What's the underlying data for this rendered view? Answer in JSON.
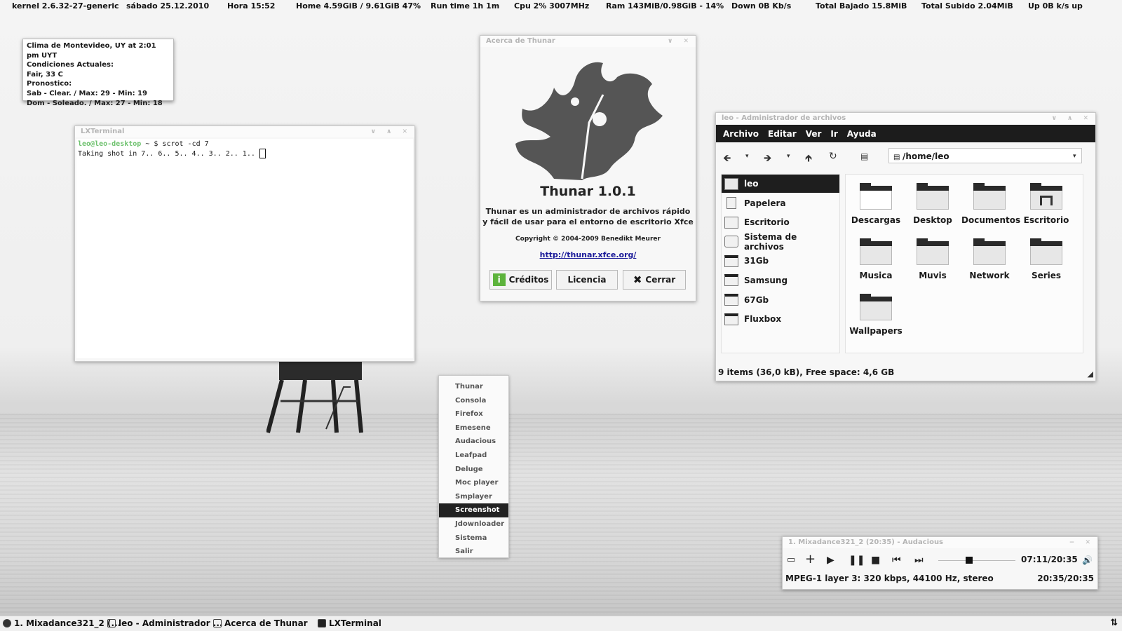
{
  "conky": {
    "kernel": "kernel  2.6.32-27-generic",
    "date": "sábado  25.12.2010",
    "time": "Hora  15:52",
    "home": "Home 4.59GiB  / 9.61GiB  47%",
    "runtime": "Run time 1h 1m",
    "cpu": "Cpu 2%  3007MHz",
    "ram": "Ram 143MiB/0.98GiB - 14%",
    "down": "Down 0B   Kb/s",
    "total_down": "Total Bajado  15.8MiB",
    "total_up": "Total Subido  2.04MiB",
    "up": "Up  0B  k/s up"
  },
  "weather": {
    "lines": [
      "Clima de Montevideo, UY at 2:01 pm UYT",
      "Condiciones Actuales:",
      "Fair, 33 C",
      "Pronostico:",
      "Sab - Clear. / Max: 29 - Min: 19",
      "Dom - Soleado. / Max: 27 - Min: 18"
    ]
  },
  "terminal": {
    "title": "LXTerminal",
    "prompt_user": "leo@leo-desktop",
    "prompt_rest": " ~ $ ",
    "command": "scrot -cd 7",
    "output": "Taking shot in 7.. 6.. 5.. 4.. 3.. 2.. 1.. "
  },
  "about": {
    "window_title": "Acerca de Thunar",
    "app_name": "Thunar 1.0.1",
    "description_line1": "Thunar es un administrador de archivos rápido",
    "description_line2": "y fácil de usar para el entorno de escritorio Xfce",
    "copyright": "Copyright © 2004-2009 Benedikt Meurer",
    "url": "http://thunar.xfce.org/",
    "btn_credits": "Créditos",
    "btn_license": "Licencia",
    "btn_close": "Cerrar"
  },
  "filemanager": {
    "title": "leo - Administrador de archivos",
    "menu": [
      "Archivo",
      "Editar",
      "Ver",
      "Ir",
      "Ayuda"
    ],
    "location": "/home/leo",
    "sidebar": [
      "leo",
      "Papelera",
      "Escritorio",
      "Sistema de archivos",
      "31Gb",
      "Samsung",
      "67Gb",
      "Fluxbox"
    ],
    "files": [
      "Descargas",
      "Desktop",
      "Documentos",
      "Escritorio",
      "Musica",
      "Muvis",
      "Network",
      "Series",
      "Wallpapers"
    ],
    "status": "9 items (36,0 kB), Free space: 4,6 GB"
  },
  "popup_menu": {
    "items": [
      "Thunar",
      "Consola",
      "Firefox",
      "Emesene",
      "Audacious",
      "Leafpad",
      "Deluge",
      "Moc player",
      "Smplayer",
      "Screenshot",
      "Jdownloader",
      "Sistema",
      "Salir"
    ],
    "selected": "Screenshot"
  },
  "audacious": {
    "title": "1. Mixadance321_2 (20:35) - Audacious",
    "position": "07:11/20:35",
    "format": "MPEG-1 layer 3: 320 kbps, 44100 Hz, stereo",
    "time_total": "20:35/20:35",
    "seek_fraction": 0.35
  },
  "taskbar": {
    "tasks": [
      "1. Mixadance321_2 (...",
      "leo - Administrador ...",
      "Acerca de Thunar",
      "LXTerminal"
    ]
  }
}
